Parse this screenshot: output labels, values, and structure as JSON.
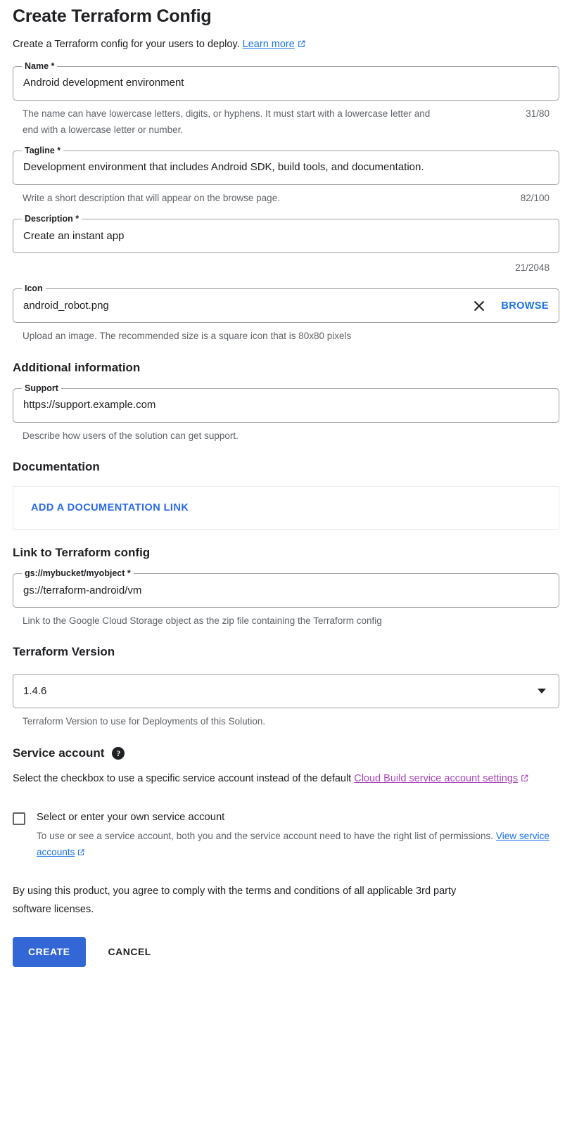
{
  "page": {
    "title": "Create Terraform Config",
    "subtitle_text": "Create a Terraform config for your users to deploy.",
    "subtitle_link": "Learn more"
  },
  "colors": {
    "accent_blue": "#1a73e8",
    "button_blue": "#3367d6",
    "visited_link_purple": "#aa46bc",
    "helper_gray": "#5f6368",
    "field_border": "#9aa0a6"
  },
  "fields": {
    "name": {
      "label": "Name *",
      "value": "Android development environment",
      "placeholder": "Name",
      "helper": "The name can have lowercase letters, digits, or hyphens. It must start with a lowercase letter and end with a lowercase letter or number.",
      "counter": "31/80"
    },
    "tagline": {
      "label": "Tagline *",
      "value": "Development environment that includes Android SDK, build tools, and documentation.",
      "placeholder": "Tagline",
      "helper": "Write a short description that will appear on the browse page.",
      "counter": "82/100"
    },
    "description": {
      "label": "Description *",
      "value": "Create an instant app",
      "placeholder": "Description",
      "counter": "21/2048"
    },
    "icon": {
      "label": "Icon",
      "value": "android_robot.png",
      "placeholder": "Icon",
      "clear_label": "Clear",
      "browse_label": "BROWSE",
      "helper": "Upload an image. The recommended size is a square icon that is 80x80 pixels"
    },
    "support": {
      "label": "Support",
      "value": "https://support.example.com",
      "placeholder": "Support",
      "helper": "Describe how users of the solution can get support."
    },
    "gcs_link": {
      "label": "gs://mybucket/myobject *",
      "value": "gs://terraform-android/vm",
      "placeholder": "gs://mybucket/myobject",
      "helper": "Link to the Google Cloud Storage object as the zip file containing the Terraform config"
    }
  },
  "sections": {
    "additional_information": "Additional information",
    "documentation": "Documentation",
    "link_to_terraform_config": "Link to Terraform config",
    "terraform_version": "Terraform Version",
    "service_account": "Service account"
  },
  "documentation": {
    "add_link_label": "ADD A DOCUMENTATION LINK"
  },
  "terraform_version": {
    "selected": "1.4.6",
    "helper": "Terraform Version to use for Deployments of this Solution.",
    "options": [
      "1.4.6"
    ]
  },
  "service_account": {
    "help_glyph": "?",
    "intro_text": "Select the checkbox to use a specific service account instead of the default ",
    "intro_link": "Cloud Build service account settings",
    "checkbox_checked": false,
    "checkbox_label": "Select or enter your own service account",
    "checkbox_sub_text": "To use or see a service account, both you and the service account need to have the right list of permissions. ",
    "checkbox_sub_link": "View service accounts"
  },
  "terms": "By using this product, you agree to comply with the terms and conditions of all applicable 3rd party software licenses.",
  "actions": {
    "create": "CREATE",
    "cancel": "CANCEL"
  }
}
